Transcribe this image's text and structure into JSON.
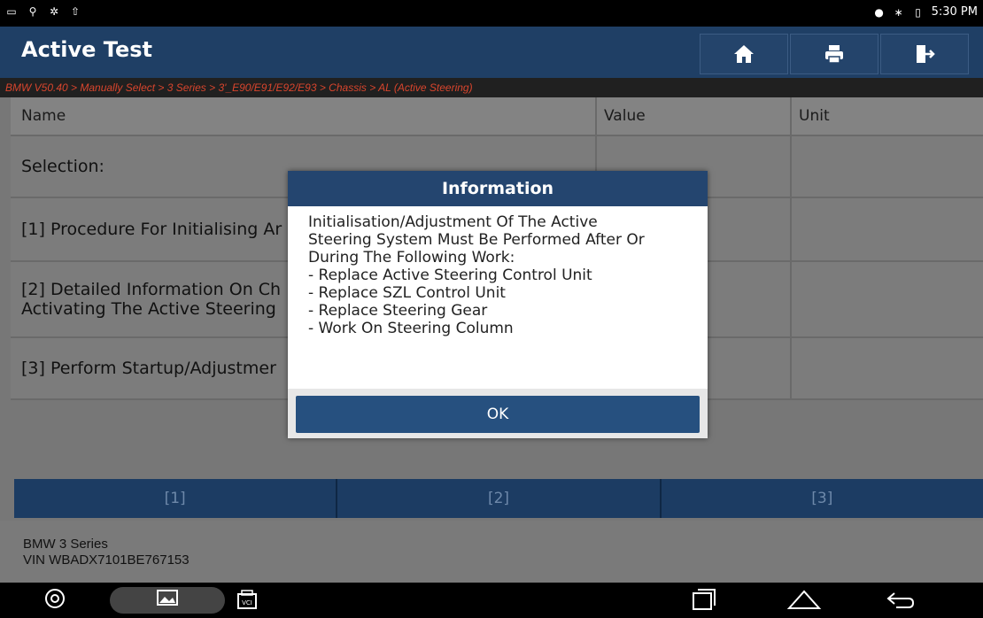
{
  "status": {
    "time": "5:30 PM"
  },
  "app": {
    "title": "Active Test"
  },
  "toolbar": {
    "home_icon": "home-icon",
    "print_icon": "print-icon",
    "exit_icon": "exit-icon"
  },
  "breadcrumb": "BMW V50.40 > Manually Select > 3 Series > 3'_E90/E91/E92/E93 > Chassis > AL (Active Steering)",
  "table": {
    "headers": {
      "name": "Name",
      "value": "Value",
      "unit": "Unit"
    },
    "rows": [
      {
        "name": "Selection:"
      },
      {
        "name": "[1] Procedure For Initialising Ar"
      },
      {
        "name": "[2] Detailed Information On Ch",
        "name2": "Activating The Active Steering"
      },
      {
        "name": "[3] Perform Startup/Adjustmer"
      }
    ]
  },
  "buttons": [
    "[1]",
    "[2]",
    "[3]"
  ],
  "footer": {
    "model": "BMW 3 Series",
    "vin": "VIN WBADX7101BE767153"
  },
  "dialog": {
    "title": "Information",
    "lines": [
      "Initialisation/Adjustment Of The Active",
      "Steering System Must Be Performed After Or",
      "During The Following Work:",
      "- Replace Active Steering Control Unit",
      "- Replace SZL Control Unit",
      "- Replace Steering Gear",
      "- Work On Steering Column"
    ],
    "ok": "OK"
  },
  "colors": {
    "accent": "#1f3f65",
    "breadcrumb": "#d8452d"
  }
}
